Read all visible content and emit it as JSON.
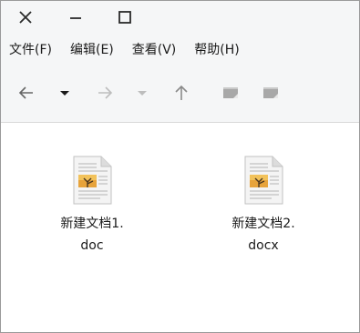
{
  "titlebar": {
    "close_icon": "close-icon",
    "minimize_icon": "minimize-icon",
    "maximize_icon": "maximize-icon"
  },
  "menu": [
    {
      "label": "文件(F)"
    },
    {
      "label": "编辑(E)"
    },
    {
      "label": "查看(V)"
    },
    {
      "label": "帮助(H)"
    }
  ],
  "toolbar": {
    "icons": [
      "back-arrow-icon",
      "dropdown-icon",
      "forward-arrow-icon",
      "dropdown-icon",
      "up-arrow-icon",
      "view-icon",
      "view-icon"
    ]
  },
  "files": [
    {
      "name_line1": "新建文档1.",
      "name_line2": "doc",
      "icon": "document-image-icon"
    },
    {
      "name_line1": "新建文档2.",
      "name_line2": "docx",
      "icon": "document-image-icon"
    }
  ],
  "colors": {
    "window_bg": "#f5f6f7",
    "content_bg": "#ffffff",
    "disabled_icon": "#b8b8b8",
    "active_icon": "#444444"
  }
}
